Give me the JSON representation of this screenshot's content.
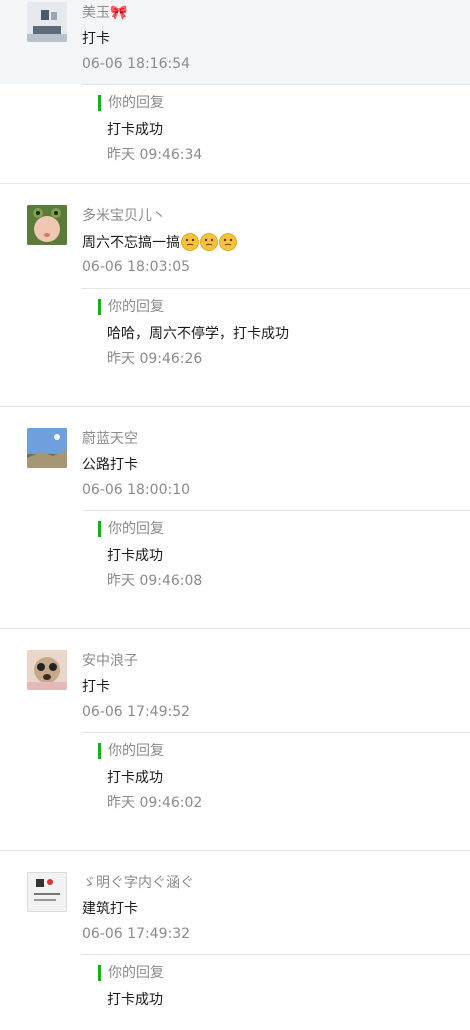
{
  "reply_label": "你的回复",
  "comments": [
    {
      "nickname": "美玉🎀",
      "message": "打卡",
      "time": "06-06 18:16:54",
      "reply_text": "打卡成功",
      "reply_time": "昨天 09:46:34",
      "avatar": "living-room-photo"
    },
    {
      "nickname": "多米宝贝儿丶",
      "message": "周六不忘搞一搞",
      "message_emoji_count": 3,
      "time": "06-06 18:03:05",
      "reply_text": "哈哈，周六不停学，打卡成功",
      "reply_time": "昨天 09:46:26",
      "avatar": "baby-frog-hat-photo"
    },
    {
      "nickname": "蔚蓝天空",
      "message": "公路打卡",
      "time": "06-06 18:00:10",
      "reply_text": "打卡成功",
      "reply_time": "昨天 09:46:08",
      "avatar": "blue-sky-photo"
    },
    {
      "nickname": "安中浪子",
      "message": "打卡",
      "time": "06-06 17:49:52",
      "reply_text": "打卡成功",
      "reply_time": "昨天 09:46:02",
      "avatar": "puppy-photo"
    },
    {
      "nickname": "ゞ明ぐ字内ぐ涵ぐ",
      "message": "建筑打卡",
      "time": "06-06 17:49:32",
      "reply_text": "打卡成功",
      "reply_time": "",
      "avatar": "calligraphy-card-photo"
    }
  ],
  "colors": {
    "accent_bar": "#1aad19",
    "meta_text": "#8b8b8b",
    "body_text": "#1a1a1a",
    "divider": "#e5e5e5",
    "highlight_bg": "#f4f5f7"
  }
}
